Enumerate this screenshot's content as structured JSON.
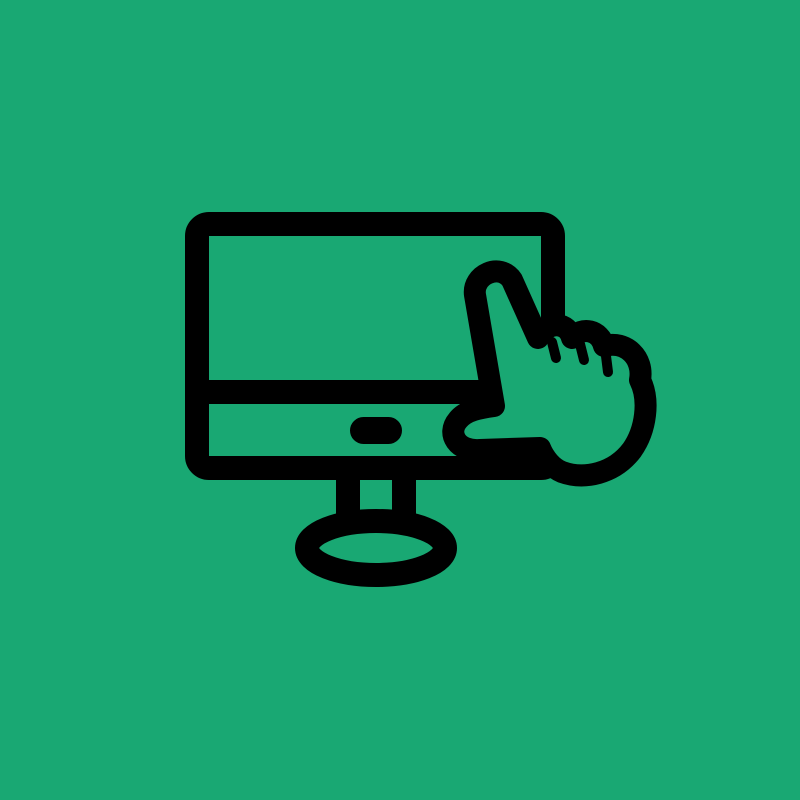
{
  "background": {
    "color": "#19a873"
  },
  "icon": {
    "name": "touchscreen-monitor-icon",
    "stroke_color": "#000000",
    "fill_color": "#19a873",
    "parts": [
      "monitor-icon",
      "pointing-hand-icon"
    ]
  }
}
